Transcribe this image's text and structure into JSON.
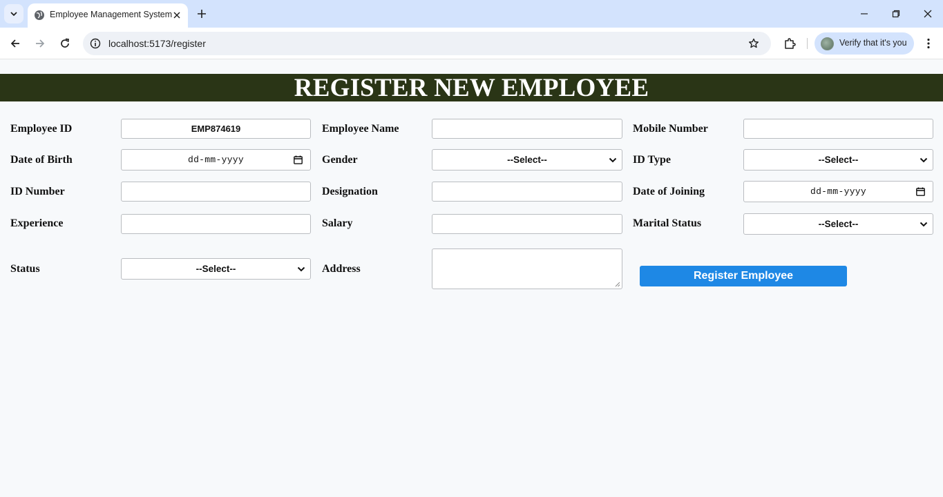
{
  "browser": {
    "tab_title": "Employee Management System",
    "url": "localhost:5173/register",
    "profile_label": "Verify that it's you"
  },
  "page": {
    "title": "REGISTER NEW EMPLOYEE",
    "banner_color": "#2a3516",
    "accent_color": "#1e88e5"
  },
  "form": {
    "employee_id": {
      "label": "Employee ID",
      "value": "EMP874619"
    },
    "employee_name": {
      "label": "Employee Name",
      "value": ""
    },
    "mobile_number": {
      "label": "Mobile Number",
      "value": ""
    },
    "date_of_birth": {
      "label": "Date of Birth",
      "placeholder": "dd-mm-yyyy"
    },
    "gender": {
      "label": "Gender",
      "selected": "--Select--"
    },
    "id_type": {
      "label": "ID Type",
      "selected": "--Select--"
    },
    "id_number": {
      "label": "ID Number",
      "value": ""
    },
    "designation": {
      "label": "Designation",
      "value": ""
    },
    "date_of_joining": {
      "label": "Date of Joining",
      "placeholder": "dd-mm-yyyy"
    },
    "experience": {
      "label": "Experience",
      "value": ""
    },
    "salary": {
      "label": "Salary",
      "value": ""
    },
    "marital_status": {
      "label": "Marital Status",
      "selected": "--Select--"
    },
    "status": {
      "label": "Status",
      "selected": "--Select--"
    },
    "address": {
      "label": "Address",
      "value": ""
    },
    "submit_label": "Register Employee"
  }
}
